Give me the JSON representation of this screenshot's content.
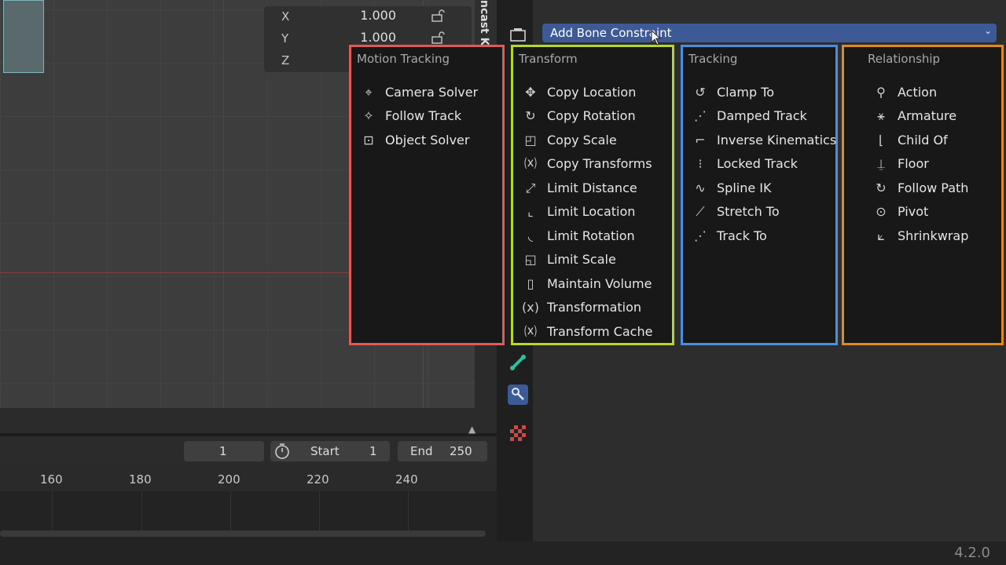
{
  "viewport": {
    "transform": [
      {
        "label": "X",
        "value": "1.000"
      },
      {
        "label": "Y",
        "value": "1.000"
      },
      {
        "label": "Z",
        "value": ""
      }
    ],
    "side_tab": "ncast K"
  },
  "timeline": {
    "current_frame": "1",
    "start_label": "Start",
    "start_value": "1",
    "end_label": "End",
    "end_value": "250",
    "ruler": [
      "160",
      "180",
      "200",
      "220",
      "240"
    ]
  },
  "add_constraint": {
    "label": "Add Bone Constraint"
  },
  "menu": {
    "motion_tracking": {
      "title": "Motion Tracking",
      "items": [
        {
          "label": "Camera Solver",
          "icon": "camera-solver-icon"
        },
        {
          "label": "Follow Track",
          "icon": "follow-track-icon"
        },
        {
          "label": "Object Solver",
          "icon": "object-solver-icon"
        }
      ]
    },
    "transform": {
      "title": "Transform",
      "items": [
        {
          "label": "Copy Location",
          "icon": "copy-location-icon"
        },
        {
          "label": "Copy Rotation",
          "icon": "copy-rotation-icon"
        },
        {
          "label": "Copy Scale",
          "icon": "copy-scale-icon"
        },
        {
          "label": "Copy Transforms",
          "icon": "copy-transforms-icon"
        },
        {
          "label": "Limit Distance",
          "icon": "limit-distance-icon"
        },
        {
          "label": "Limit Location",
          "icon": "limit-location-icon"
        },
        {
          "label": "Limit Rotation",
          "icon": "limit-rotation-icon"
        },
        {
          "label": "Limit Scale",
          "icon": "limit-scale-icon"
        },
        {
          "label": "Maintain Volume",
          "icon": "maintain-volume-icon"
        },
        {
          "label": "Transformation",
          "icon": "transformation-icon"
        },
        {
          "label": "Transform Cache",
          "icon": "transform-cache-icon"
        }
      ]
    },
    "tracking": {
      "title": "Tracking",
      "items": [
        {
          "label": "Clamp To",
          "icon": "clamp-to-icon"
        },
        {
          "label": "Damped Track",
          "icon": "damped-track-icon"
        },
        {
          "label": "Inverse Kinematics",
          "icon": "inverse-kinematics-icon"
        },
        {
          "label": "Locked Track",
          "icon": "locked-track-icon"
        },
        {
          "label": "Spline IK",
          "icon": "spline-ik-icon"
        },
        {
          "label": "Stretch To",
          "icon": "stretch-to-icon"
        },
        {
          "label": "Track To",
          "icon": "track-to-icon"
        }
      ]
    },
    "relationship": {
      "title": "Relationship",
      "items": [
        {
          "label": "Action",
          "icon": "action-icon"
        },
        {
          "label": "Armature",
          "icon": "armature-icon"
        },
        {
          "label": "Child Of",
          "icon": "child-of-icon"
        },
        {
          "label": "Floor",
          "icon": "floor-icon"
        },
        {
          "label": "Follow Path",
          "icon": "follow-path-icon"
        },
        {
          "label": "Pivot",
          "icon": "pivot-icon"
        },
        {
          "label": "Shrinkwrap",
          "icon": "shrinkwrap-icon"
        }
      ]
    }
  },
  "highlight_colors": {
    "motion_tracking": "#e05a5a",
    "transform": "#b6d82a",
    "tracking": "#4a8ee0",
    "relationship": "#e08a1e",
    "accent_button": "#3d5a96"
  },
  "status": {
    "version": "4.2.0"
  }
}
